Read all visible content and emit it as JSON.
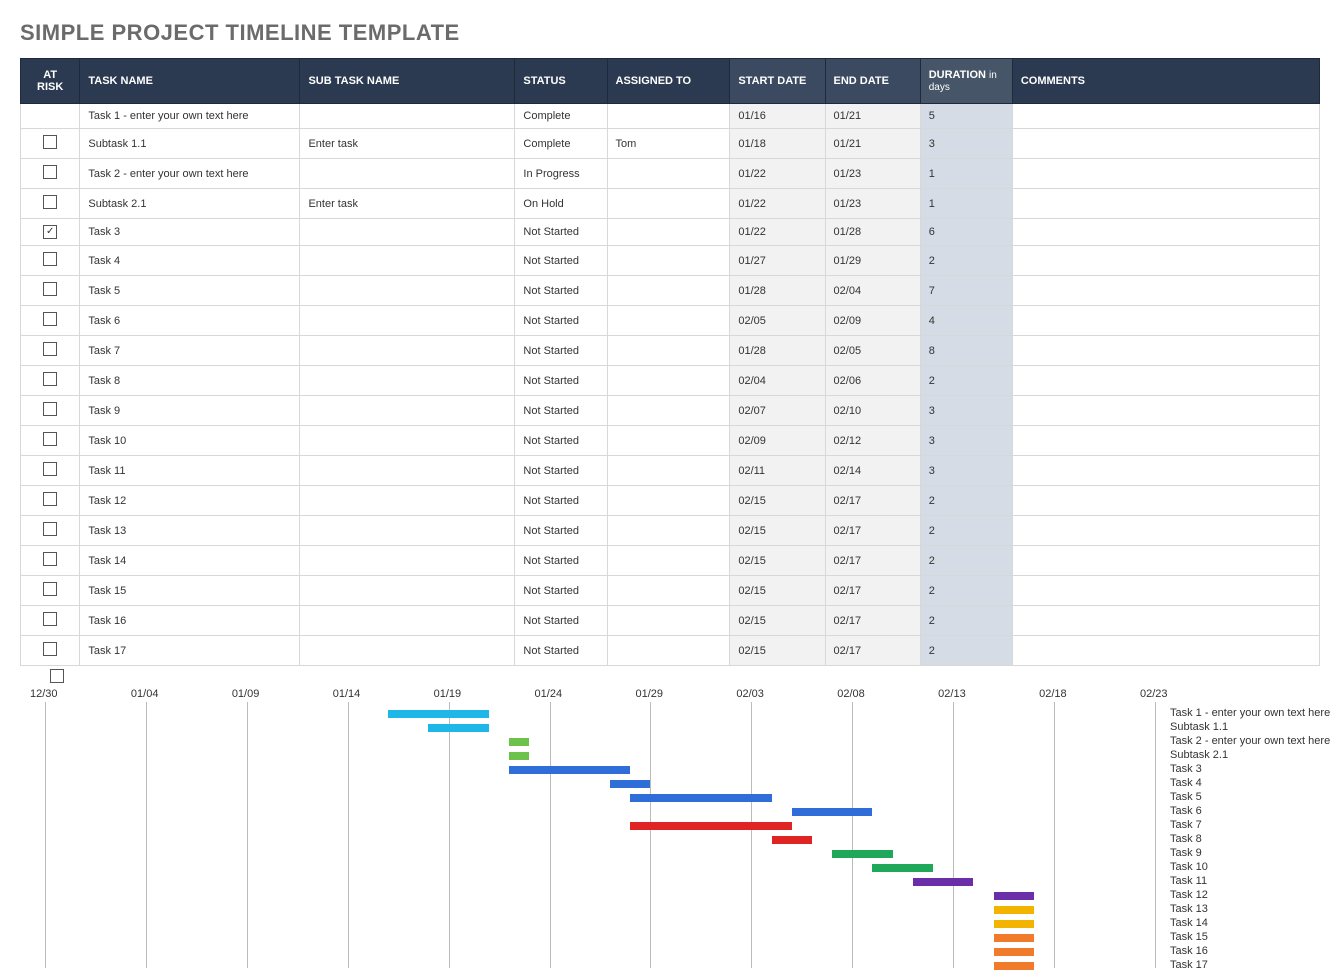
{
  "title": "SIMPLE PROJECT TIMELINE TEMPLATE",
  "headers": {
    "risk": "AT RISK",
    "task": "TASK NAME",
    "sub": "SUB TASK NAME",
    "status": "STATUS",
    "assigned": "ASSIGNED TO",
    "start": "START DATE",
    "end": "END DATE",
    "duration": "DURATION",
    "duration_suffix": "in days",
    "comments": "COMMENTS"
  },
  "rows": [
    {
      "risk": null,
      "task": "Task 1 - enter your own text here",
      "sub": "",
      "status": "Complete",
      "assigned": "",
      "start": "01/16",
      "end": "01/21",
      "dur": "5",
      "comments": ""
    },
    {
      "risk": false,
      "task": "Subtask 1.1",
      "sub": "Enter task",
      "status": "Complete",
      "assigned": "Tom",
      "start": "01/18",
      "end": "01/21",
      "dur": "3",
      "comments": ""
    },
    {
      "risk": false,
      "task": "Task 2 - enter your own text here",
      "sub": "",
      "status": "In Progress",
      "assigned": "",
      "start": "01/22",
      "end": "01/23",
      "dur": "1",
      "comments": ""
    },
    {
      "risk": false,
      "task": "Subtask 2.1",
      "sub": "Enter task",
      "status": "On Hold",
      "assigned": "",
      "start": "01/22",
      "end": "01/23",
      "dur": "1",
      "comments": ""
    },
    {
      "risk": true,
      "task": "Task 3",
      "sub": "",
      "status": "Not Started",
      "assigned": "",
      "start": "01/22",
      "end": "01/28",
      "dur": "6",
      "comments": ""
    },
    {
      "risk": false,
      "task": "Task 4",
      "sub": "",
      "status": "Not Started",
      "assigned": "",
      "start": "01/27",
      "end": "01/29",
      "dur": "2",
      "comments": ""
    },
    {
      "risk": false,
      "task": "Task 5",
      "sub": "",
      "status": "Not Started",
      "assigned": "",
      "start": "01/28",
      "end": "02/04",
      "dur": "7",
      "comments": ""
    },
    {
      "risk": false,
      "task": "Task 6",
      "sub": "",
      "status": "Not Started",
      "assigned": "",
      "start": "02/05",
      "end": "02/09",
      "dur": "4",
      "comments": ""
    },
    {
      "risk": false,
      "task": "Task 7",
      "sub": "",
      "status": "Not Started",
      "assigned": "",
      "start": "01/28",
      "end": "02/05",
      "dur": "8",
      "comments": ""
    },
    {
      "risk": false,
      "task": "Task 8",
      "sub": "",
      "status": "Not Started",
      "assigned": "",
      "start": "02/04",
      "end": "02/06",
      "dur": "2",
      "comments": ""
    },
    {
      "risk": false,
      "task": "Task 9",
      "sub": "",
      "status": "Not Started",
      "assigned": "",
      "start": "02/07",
      "end": "02/10",
      "dur": "3",
      "comments": ""
    },
    {
      "risk": false,
      "task": "Task 10",
      "sub": "",
      "status": "Not Started",
      "assigned": "",
      "start": "02/09",
      "end": "02/12",
      "dur": "3",
      "comments": ""
    },
    {
      "risk": false,
      "task": "Task 11",
      "sub": "",
      "status": "Not Started",
      "assigned": "",
      "start": "02/11",
      "end": "02/14",
      "dur": "3",
      "comments": ""
    },
    {
      "risk": false,
      "task": "Task 12",
      "sub": "",
      "status": "Not Started",
      "assigned": "",
      "start": "02/15",
      "end": "02/17",
      "dur": "2",
      "comments": ""
    },
    {
      "risk": false,
      "task": "Task 13",
      "sub": "",
      "status": "Not Started",
      "assigned": "",
      "start": "02/15",
      "end": "02/17",
      "dur": "2",
      "comments": ""
    },
    {
      "risk": false,
      "task": "Task 14",
      "sub": "",
      "status": "Not Started",
      "assigned": "",
      "start": "02/15",
      "end": "02/17",
      "dur": "2",
      "comments": ""
    },
    {
      "risk": false,
      "task": "Task 15",
      "sub": "",
      "status": "Not Started",
      "assigned": "",
      "start": "02/15",
      "end": "02/17",
      "dur": "2",
      "comments": ""
    },
    {
      "risk": false,
      "task": "Task 16",
      "sub": "",
      "status": "Not Started",
      "assigned": "",
      "start": "02/15",
      "end": "02/17",
      "dur": "2",
      "comments": ""
    },
    {
      "risk": false,
      "task": "Task 17",
      "sub": "",
      "status": "Not Started",
      "assigned": "",
      "start": "02/15",
      "end": "02/17",
      "dur": "2",
      "comments": ""
    }
  ],
  "extra_checkbox": false,
  "chart_data": {
    "type": "gantt",
    "axis_start": "12/30",
    "axis_end": "02/23",
    "axis_ticks": [
      "12/30",
      "01/04",
      "01/09",
      "01/14",
      "01/19",
      "01/24",
      "01/29",
      "02/03",
      "02/08",
      "02/13",
      "02/18",
      "02/23"
    ],
    "series": [
      {
        "name": "Task 1 - enter your own text here",
        "start": "01/16",
        "end": "01/21",
        "color": "#1fb6e8"
      },
      {
        "name": "Subtask 1.1",
        "start": "01/18",
        "end": "01/21",
        "color": "#1fb6e8"
      },
      {
        "name": "Task 2 - enter your own text here",
        "start": "01/22",
        "end": "01/23",
        "color": "#6cc24a"
      },
      {
        "name": "Subtask 2.1",
        "start": "01/22",
        "end": "01/23",
        "color": "#6cc24a"
      },
      {
        "name": "Task 3",
        "start": "01/22",
        "end": "01/28",
        "color": "#2f6ed9"
      },
      {
        "name": "Task 4",
        "start": "01/27",
        "end": "01/29",
        "color": "#2f6ed9"
      },
      {
        "name": "Task 5",
        "start": "01/28",
        "end": "02/04",
        "color": "#2f6ed9"
      },
      {
        "name": "Task 6",
        "start": "02/05",
        "end": "02/09",
        "color": "#2f6ed9"
      },
      {
        "name": "Task 7",
        "start": "01/28",
        "end": "02/05",
        "color": "#e02424"
      },
      {
        "name": "Task 8",
        "start": "02/04",
        "end": "02/06",
        "color": "#e02424"
      },
      {
        "name": "Task 9",
        "start": "02/07",
        "end": "02/10",
        "color": "#1fa85a"
      },
      {
        "name": "Task 10",
        "start": "02/09",
        "end": "02/12",
        "color": "#1fa85a"
      },
      {
        "name": "Task 11",
        "start": "02/11",
        "end": "02/14",
        "color": "#6a2ea8"
      },
      {
        "name": "Task 12",
        "start": "02/15",
        "end": "02/17",
        "color": "#6a2ea8"
      },
      {
        "name": "Task 13",
        "start": "02/15",
        "end": "02/17",
        "color": "#f2b400"
      },
      {
        "name": "Task 14",
        "start": "02/15",
        "end": "02/17",
        "color": "#f2b400"
      },
      {
        "name": "Task 15",
        "start": "02/15",
        "end": "02/17",
        "color": "#f07c2b"
      },
      {
        "name": "Task 16",
        "start": "02/15",
        "end": "02/17",
        "color": "#f07c2b"
      },
      {
        "name": "Task 17",
        "start": "02/15",
        "end": "02/17",
        "color": "#f07c2b"
      }
    ]
  }
}
